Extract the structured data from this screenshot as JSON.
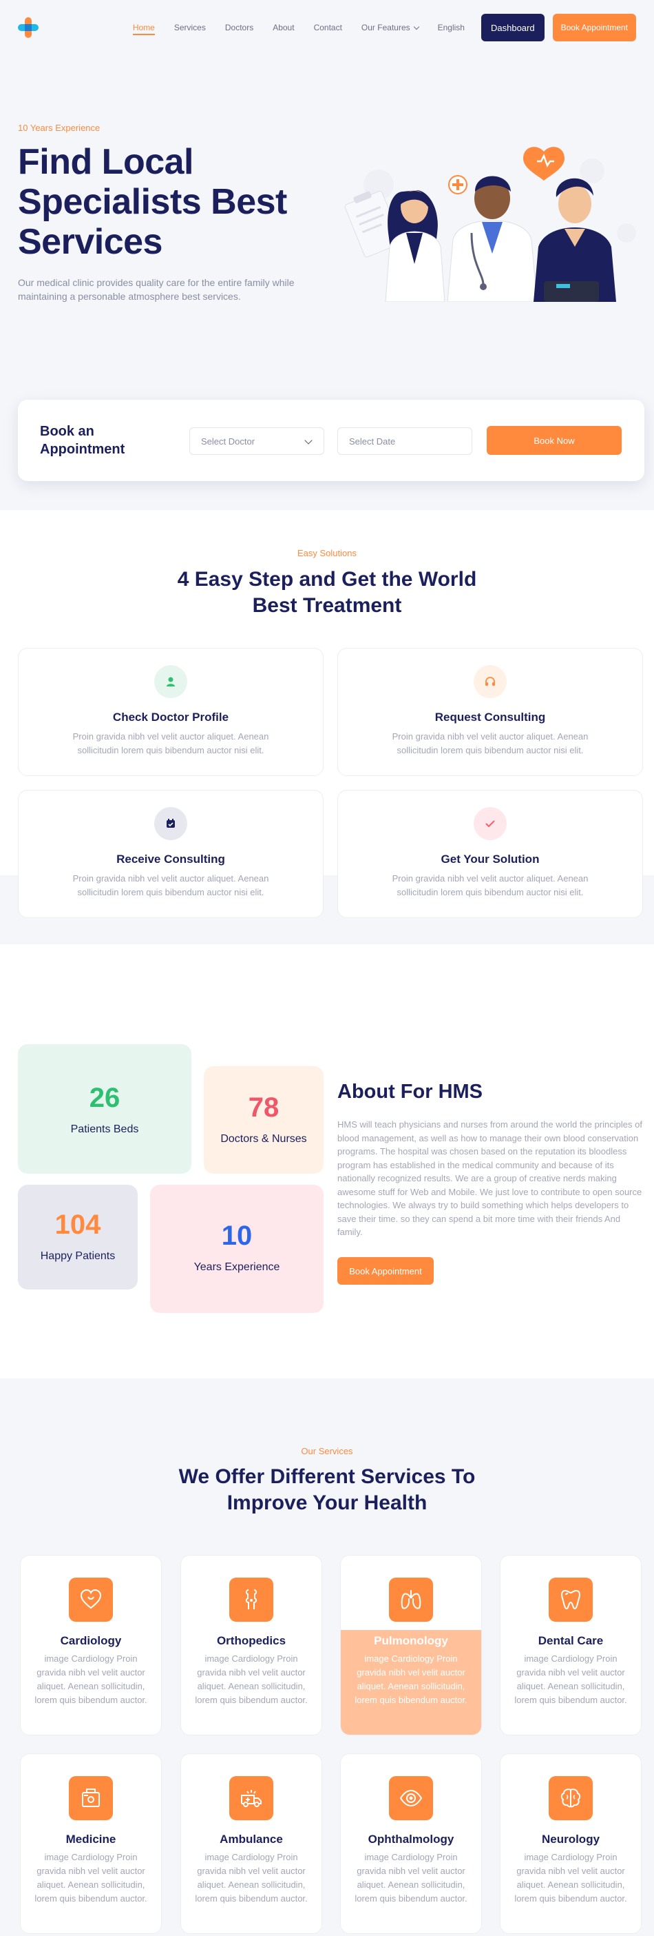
{
  "nav": {
    "items": [
      "Home",
      "Services",
      "Doctors",
      "About",
      "Contact",
      "Our Features",
      "English"
    ],
    "dashboard": "Dashboard",
    "book": "Book Appointment"
  },
  "hero": {
    "experience": "10 Years Experience",
    "title": "Find Local Specialists Best Services",
    "description": "Our medical clinic provides quality care for the entire family while maintaining a personable atmosphere best services."
  },
  "booking": {
    "title": "Book an Appointment",
    "doctor_placeholder": "Select Doctor",
    "date_placeholder": "Select Date",
    "button": "Book Now"
  },
  "steps": {
    "subtitle": "Easy Solutions",
    "title": "4 Easy Step and Get the World Best Treatment",
    "items": [
      {
        "title": "Check Doctor Profile",
        "text": "Proin gravida nibh vel velit auctor aliquet. Aenean sollicitudin lorem quis bibendum auctor nisi elit."
      },
      {
        "title": "Request Consulting",
        "text": "Proin gravida nibh vel velit auctor aliquet. Aenean sollicitudin lorem quis bibendum auctor nisi elit."
      },
      {
        "title": "Receive Consulting",
        "text": "Proin gravida nibh vel velit auctor aliquet. Aenean sollicitudin lorem quis bibendum auctor nisi elit."
      },
      {
        "title": "Get Your Solution",
        "text": "Proin gravida nibh vel velit auctor aliquet. Aenean sollicitudin lorem quis bibendum auctor nisi elit."
      }
    ],
    "icon_colors": [
      "#2fbf71",
      "#ff8a3d",
      "#1b1f5c",
      "#ff5a6e"
    ]
  },
  "about": {
    "stats": [
      {
        "number": "26",
        "label": "Patients Beds",
        "color": "#2fbf71"
      },
      {
        "number": "78",
        "label": "Doctors & Nurses",
        "color": "#f0566a"
      },
      {
        "number": "104",
        "label": "Happy Patients",
        "color": "#ff8a3d"
      },
      {
        "number": "10",
        "label": "Years Experience",
        "color": "#2d67e8"
      }
    ],
    "title": "About For HMS",
    "text": "HMS will teach physicians and nurses from around the world the principles of blood management, as well as how to manage their own blood conservation programs. The hospital was chosen based on the reputation its bloodless program has established in the medical community and because of its nationally recognized results. We are a group of creative nerds making awesome stuff for Web and Mobile. We just love to contribute to open source technologies. We always try to build something which helps developers to save their time. so they can spend a bit more time with their friends And family.",
    "button": "Book Appointment"
  },
  "services": {
    "subtitle": "Our Services",
    "title": "We Offer Different Services To Improve Your Health",
    "items": [
      {
        "title": "Cardiology",
        "text": "image Cardiology Proin gravida nibh vel velit auctor aliquet. Aenean sollicitudin, lorem quis bibendum auctor.",
        "icon": "heart-icon"
      },
      {
        "title": "Orthopedics",
        "text": "image Cardiology Proin gravida nibh vel velit auctor aliquet. Aenean sollicitudin, lorem quis bibendum auctor.",
        "icon": "bone-icon"
      },
      {
        "title": "Pulmonology",
        "text": "image Cardiology Proin gravida nibh vel velit auctor aliquet. Aenean sollicitudin, lorem quis bibendum auctor.",
        "icon": "lungs-icon"
      },
      {
        "title": "Dental Care",
        "text": "image Cardiology Proin gravida nibh vel velit auctor aliquet. Aenean sollicitudin, lorem quis bibendum auctor.",
        "icon": "tooth-icon"
      },
      {
        "title": "Medicine",
        "text": "image Cardiology Proin gravida nibh vel velit auctor aliquet. Aenean sollicitudin, lorem quis bibendum auctor.",
        "icon": "medicine-icon"
      },
      {
        "title": "Ambulance",
        "text": "image Cardiology Proin gravida nibh vel velit auctor aliquet. Aenean sollicitudin, lorem quis bibendum auctor.",
        "icon": "ambulance-icon"
      },
      {
        "title": "Ophthalmology",
        "text": "image Cardiology Proin gravida nibh vel velit auctor aliquet. Aenean sollicitudin, lorem quis bibendum auctor.",
        "icon": "eye-icon"
      },
      {
        "title": "Neurology",
        "text": "image Cardiology Proin gravida nibh vel velit auctor aliquet. Aenean sollicitudin, lorem quis bibendum auctor.",
        "icon": "brain-icon"
      }
    ]
  }
}
